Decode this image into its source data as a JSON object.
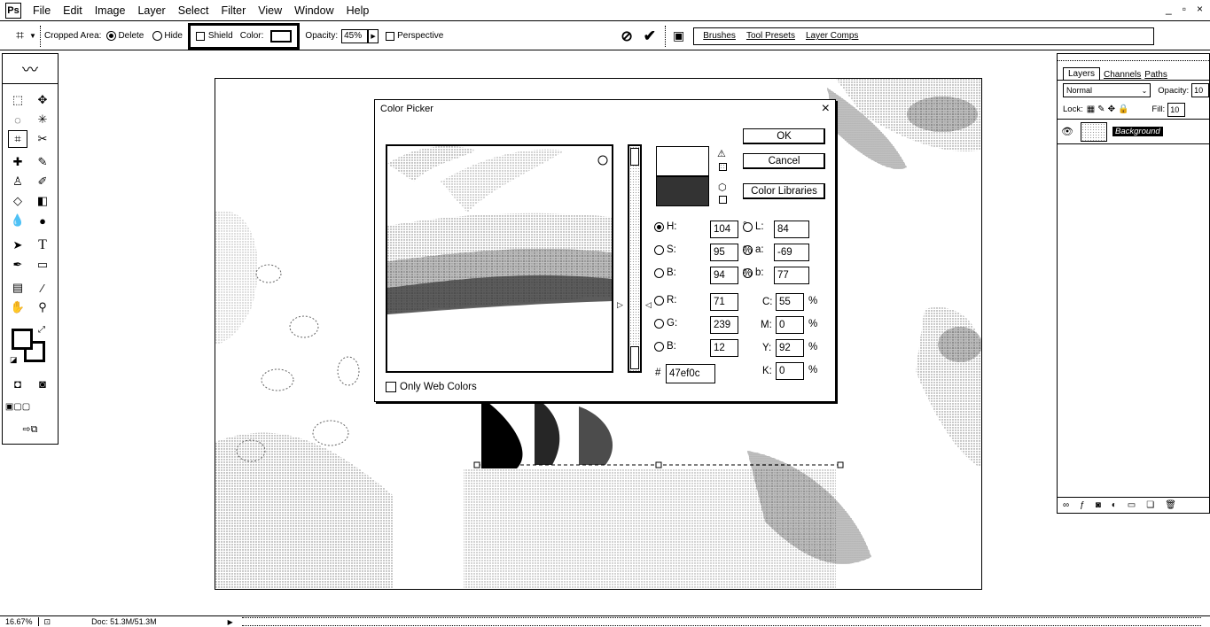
{
  "menubar": {
    "items": [
      "File",
      "Edit",
      "Image",
      "Layer",
      "Select",
      "Filter",
      "View",
      "Window",
      "Help"
    ],
    "window_controls": [
      "_",
      "▫",
      "×"
    ]
  },
  "optionsbar": {
    "cropped_area_label": "Cropped Area:",
    "delete_label": "Delete",
    "hide_label": "Hide",
    "shield_label": "Shield",
    "color_label": "Color:",
    "opacity_label": "Opacity:",
    "opacity_value": "45%",
    "perspective_label": "Perspective",
    "panel_tabs": [
      "Brushes",
      "Tool Presets",
      "Layer Comps"
    ]
  },
  "color_picker": {
    "title": "Color Picker",
    "ok_label": "OK",
    "cancel_label": "Cancel",
    "libraries_label": "Color Libraries",
    "web_colors_label": "Only Web Colors",
    "hsb": [
      {
        "label": "H:",
        "value": "104",
        "unit": "°"
      },
      {
        "label": "S:",
        "value": "95",
        "unit": "%"
      },
      {
        "label": "B:",
        "value": "94",
        "unit": "%"
      }
    ],
    "rgb": [
      {
        "label": "R:",
        "value": "71"
      },
      {
        "label": "G:",
        "value": "239"
      },
      {
        "label": "B:",
        "value": "12"
      }
    ],
    "lab": [
      {
        "label": "L:",
        "value": "84"
      },
      {
        "label": "a:",
        "value": "-69"
      },
      {
        "label": "b:",
        "value": "77"
      }
    ],
    "cmyk": [
      {
        "label": "C:",
        "value": "55",
        "unit": "%"
      },
      {
        "label": "M:",
        "value": "0",
        "unit": "%"
      },
      {
        "label": "Y:",
        "value": "92",
        "unit": "%"
      },
      {
        "label": "K:",
        "value": "0",
        "unit": "%"
      }
    ],
    "hex_label": "#",
    "hex_value": "47ef0c"
  },
  "layers_panel": {
    "tabs": [
      "Layers",
      "Channels",
      "Paths"
    ],
    "blend_mode": "Normal",
    "opacity_label": "Opacity:",
    "opacity_value": "10",
    "lock_label": "Lock:",
    "fill_label": "Fill:",
    "fill_value": "10",
    "layer_name": "Background"
  },
  "status": {
    "zoom": "16.67%",
    "doc": "Doc: 51.3M/51.3M"
  }
}
